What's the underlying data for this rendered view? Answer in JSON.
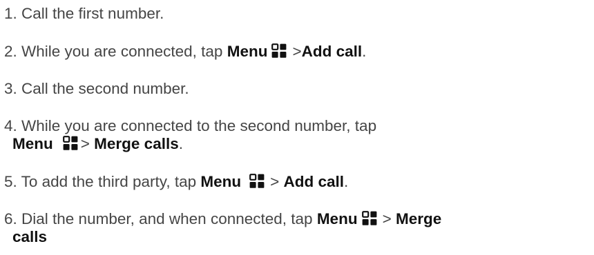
{
  "steps": [
    {
      "line1": [
        "1. Call the first number."
      ]
    },
    {
      "prefix": "2. While you are connected, tap ",
      "menu": "Menu",
      "icon": "menu-grid-icon",
      "sep": ">",
      "action": "Add call",
      "suffix": "."
    },
    {
      "text": "3. Call the second number."
    },
    {
      "line1": "4. While you are connected to the second number, tap",
      "menu": "Menu",
      "icon": "menu-grid-icon",
      "sep": ">",
      "action": "Merge calls",
      "suffix": "."
    },
    {
      "prefix": "5. To add the third party, tap ",
      "menu": "Menu",
      "icon": "menu-grid-icon",
      "sep": ">",
      "action": "Add call",
      "suffix": "."
    },
    {
      "prefix": "6. Dial the number, and when connected, tap ",
      "menu": "Menu",
      "icon": "menu-grid-icon",
      "sep": ">",
      "action_line1": "Merge",
      "action_line2": "calls"
    }
  ],
  "step1_text": "1. Call the first number."
}
